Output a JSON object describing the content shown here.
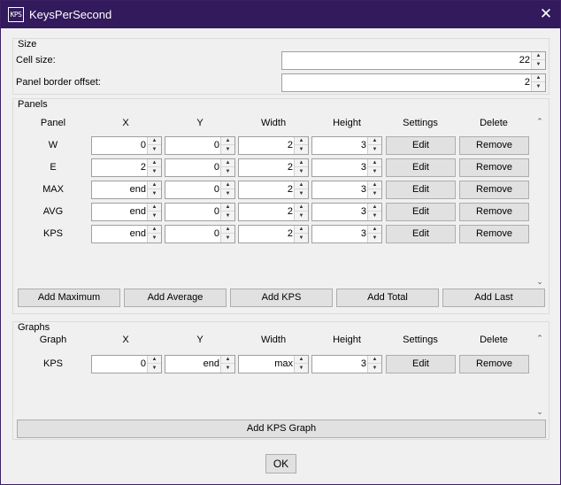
{
  "window": {
    "title": "KeysPerSecond",
    "icon_text": "KPS",
    "icon": "kps-app-icon",
    "close_glyph": "✕",
    "title_bar_color": "#321a5c"
  },
  "size": {
    "group_title": "Size",
    "cell_size_label": "Cell size:",
    "cell_size_value": "22",
    "border_offset_label": "Panel border offset:",
    "border_offset_value": "2"
  },
  "panels": {
    "group_title": "Panels",
    "headers": [
      "Panel",
      "X",
      "Y",
      "Width",
      "Height",
      "Settings",
      "Delete"
    ],
    "rows": [
      {
        "name": "W",
        "x": "0",
        "y": "0",
        "width": "2",
        "height": "3",
        "settings": "Edit",
        "delete": "Remove"
      },
      {
        "name": "E",
        "x": "2",
        "y": "0",
        "width": "2",
        "height": "3",
        "settings": "Edit",
        "delete": "Remove"
      },
      {
        "name": "MAX",
        "x": "end",
        "y": "0",
        "width": "2",
        "height": "3",
        "settings": "Edit",
        "delete": "Remove"
      },
      {
        "name": "AVG",
        "x": "end",
        "y": "0",
        "width": "2",
        "height": "3",
        "settings": "Edit",
        "delete": "Remove"
      },
      {
        "name": "KPS",
        "x": "end",
        "y": "0",
        "width": "2",
        "height": "3",
        "settings": "Edit",
        "delete": "Remove"
      }
    ],
    "add_buttons": [
      "Add Maximum",
      "Add Average",
      "Add KPS",
      "Add Total",
      "Add Last"
    ]
  },
  "graphs": {
    "group_title": "Graphs",
    "headers": [
      "Graph",
      "X",
      "Y",
      "Width",
      "Height",
      "Settings",
      "Delete"
    ],
    "rows": [
      {
        "name": "KPS",
        "x": "0",
        "y": "end",
        "width": "max",
        "height": "3",
        "settings": "Edit",
        "delete": "Remove"
      }
    ],
    "add_button": "Add KPS Graph"
  },
  "ok_label": "OK",
  "spinner_up_glyph": "▲",
  "spinner_down_glyph": "▼",
  "scroll_up_glyph": "⌃",
  "scroll_down_glyph": "⌄"
}
